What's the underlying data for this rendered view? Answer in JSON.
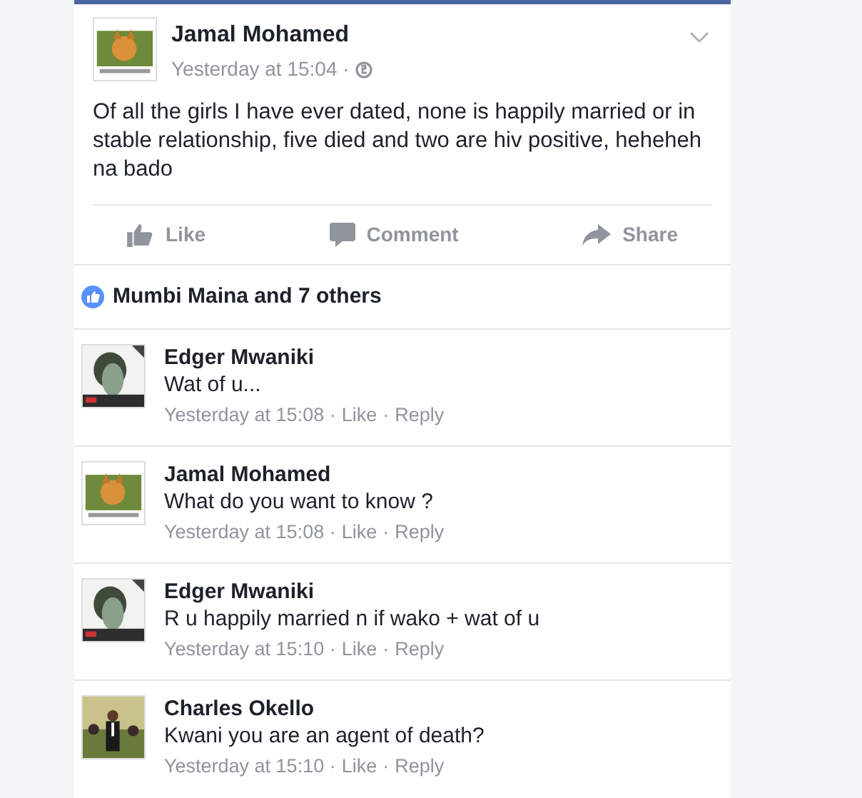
{
  "post": {
    "author": "Jamal Mohamed",
    "time": "Yesterday at 15:04 ·",
    "text": "Of all the girls I have ever dated, none is happily married or in stable relationship, five died and two are hiv positive, heheheh na bado"
  },
  "actions": [
    {
      "kind": "like",
      "label": "Like"
    },
    {
      "kind": "comment",
      "label": "Comment"
    },
    {
      "kind": "share",
      "label": "Share"
    }
  ],
  "reactions": {
    "text": "Mumbi Maina and 7 others"
  },
  "comments": [
    {
      "author": "Edger Mwaniki",
      "text": "Wat of u...",
      "time": "Yesterday at 15:08 ·",
      "like": "Like",
      "dot": "·",
      "reply": "Reply"
    },
    {
      "author": "Jamal Mohamed",
      "text": "What do you want to know ?",
      "time": "Yesterday at 15:08 ·",
      "like": "Like",
      "dot": "·",
      "reply": "Reply"
    },
    {
      "author": "Edger Mwaniki",
      "text": "R u happily married n if wako + wat of u",
      "time": "Yesterday at 15:10 ·",
      "like": "Like",
      "dot": "·",
      "reply": "Reply"
    },
    {
      "author": "Charles Okello",
      "text": "Kwani you are an agent of death?",
      "time": "Yesterday at 15:10 ·",
      "like": "Like",
      "dot": "·",
      "reply": "Reply"
    }
  ]
}
